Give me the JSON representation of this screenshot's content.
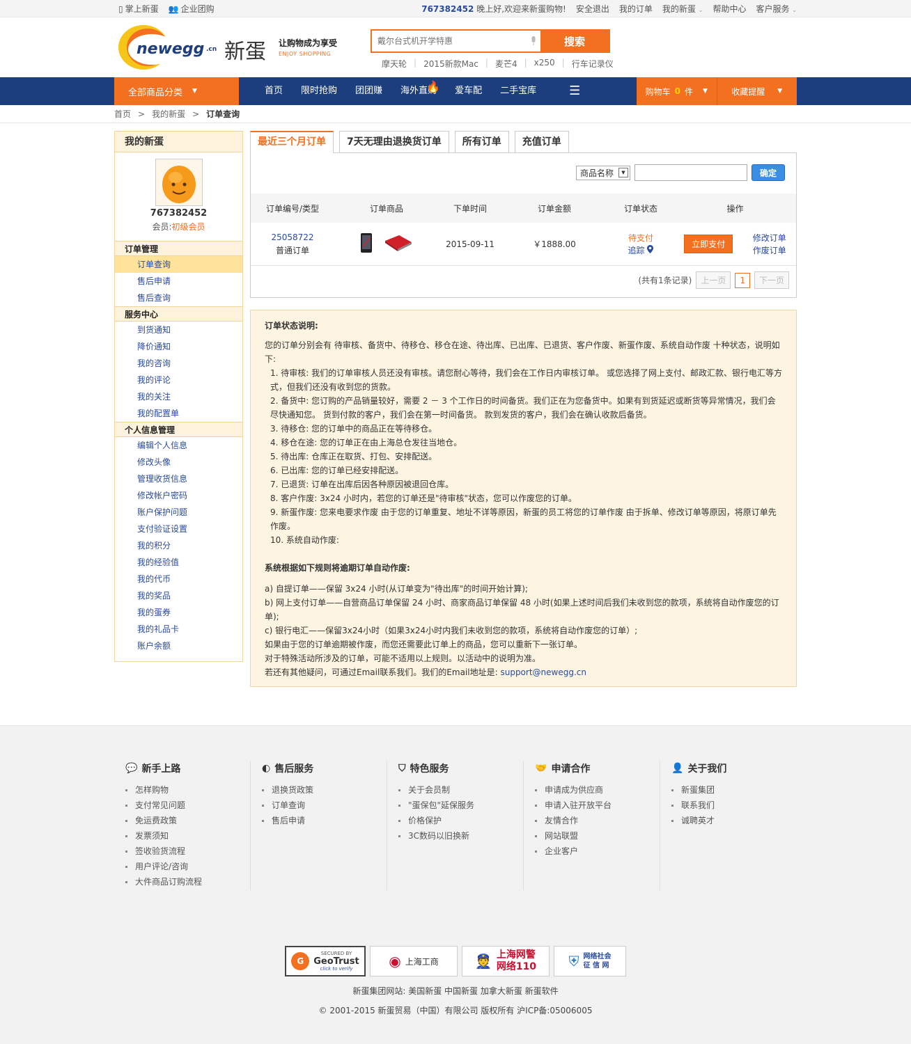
{
  "topbar": {
    "mobile": "掌上新蛋",
    "enterprise": "企业团购",
    "user": "767382452",
    "greeting": "晚上好,欢迎来新蛋购物!",
    "logout": "安全退出",
    "my_orders": "我的订单",
    "my_newegg": "我的新蛋",
    "help": "帮助中心",
    "service": "客户服务"
  },
  "header": {
    "logo_text": "newegg",
    "logo_suffix": ".cn",
    "brand_cn": "新蛋",
    "slogan": "让购物成为享受",
    "slogan_en": "ENJOY SHOPPING",
    "search_placeholder": "戴尔台式机开学特惠",
    "search_button": "搜索",
    "hotwords": [
      "摩天轮",
      "2015新款Mac",
      "麦芒4",
      "x250",
      "行车记录仪"
    ]
  },
  "nav": {
    "all_categories": "全部商品分类",
    "items": [
      "首页",
      "限时抢购",
      "团团赚",
      "海外直购",
      "爱车配",
      "二手宝库"
    ],
    "cart_label": "购物车",
    "cart_count": "0",
    "cart_unit": "件",
    "favorites": "收藏提醒"
  },
  "breadcrumb": {
    "home": "首页",
    "mynewegg": "我的新蛋",
    "current": "订单查询"
  },
  "sidebar": {
    "title": "我的新蛋",
    "user_id": "767382452",
    "member_label": "会员:",
    "member_level": "初级会员",
    "groups": [
      {
        "title": "订单管理",
        "items": [
          "订单查询",
          "售后申请",
          "售后查询"
        ]
      },
      {
        "title": "服务中心",
        "items": [
          "到货通知",
          "降价通知",
          "我的咨询",
          "我的评论",
          "我的关注",
          "我的配置单"
        ]
      },
      {
        "title": "个人信息管理",
        "items": [
          "编辑个人信息",
          "修改头像",
          "管理收货信息",
          "修改帐户密码",
          "账户保护问题",
          "支付验证设置",
          "我的积分",
          "我的经验值",
          "我的代币",
          "我的奖品",
          "我的蛋券",
          "我的礼品卡",
          "账户余额"
        ]
      }
    ]
  },
  "tabs": [
    "最近三个月订单",
    "7天无理由退换货订单",
    "所有订单",
    "充值订单"
  ],
  "filter": {
    "select_value": "商品名称",
    "confirm": "确定"
  },
  "table": {
    "headers": [
      "订单编号/类型",
      "订单商品",
      "下单时间",
      "订单金额",
      "订单状态",
      "操作"
    ],
    "rows": [
      {
        "order_id": "25058722",
        "order_type": "普通订单",
        "date": "2015-09-11",
        "amount": "￥1888.00",
        "status": "待支付",
        "track": "追踪",
        "pay": "立即支付",
        "modify": "修改订单",
        "cancel": "作废订单"
      }
    ]
  },
  "pager": {
    "summary": "(共有1条记录)",
    "prev": "上一页",
    "page": "1",
    "next": "下一页"
  },
  "note": {
    "title": "订单状态说明:",
    "intro": "您的订单分别会有 待审核、备货中、待移仓、移仓在途、待出库、已出库、已退货、客户作废、新蛋作废、系统自动作废 十种状态，说明如下:",
    "items": [
      "1. 待审核:   我们的订单审核人员还没有审核。请您耐心等待，我们会在工作日内审核订单。 或您选择了网上支付、邮政汇款、银行电汇等方式，但我们还没有收到您的货款。",
      "2. 备货中:   您订购的产品销量较好，需要 2 － 3 个工作日的时间备货。我们正在为您备货中。如果有到货延迟或断货等异常情况，我们会尽快通知您。 货到付款的客户，我们会在第一时间备货。 款到发货的客户，我们会在确认收款后备货。",
      "3. 待移仓:   您的订单中的商品正在等待移仓。",
      "4. 移仓在途:   您的订单正在由上海总仓发往当地仓。",
      "5. 待出库:   仓库正在取货、打包、安排配送。",
      "6. 已出库:   您的订单已经安排配送。",
      "7. 已退货:   订单在出库后因各种原因被退回仓库。",
      "8. 客户作废:   3x24 小时内，若您的订单还是\"待审核\"状态，您可以作废您的订单。",
      "9. 新蛋作废:   您来电要求作废 由于您的订单重复、地址不详等原因，新蛋的员工将您的订单作废 由于拆单、修改订单等原因，将原订单先作废。",
      "10. 系统自动作废:"
    ],
    "rule_title": "系统根据如下规则将逾期订单自动作废:",
    "rules": [
      "a) 自提订单——保留 3x24 小时(从订单变为\"待出库\"的时间开始计算);",
      "b) 网上支付订单——自营商品订单保留 24 小时、商家商品订单保留 48 小时(如果上述时间后我们未收到您的款项，系统将自动作废您的订单);",
      "c) 银行电汇——保留3x24小时（如果3x24小时内我们未收到您的款项，系统将自动作废您的订单）;",
      "如果由于您的订单逾期被作废，而您还需要此订单上的商品，您可以重新下一张订单。",
      "对于特殊活动所涉及的订单，可能不适用以上规则。以活动中的说明为准。"
    ],
    "contact": "若还有其他疑问，可通过Email联系我们。我们的Email地址是:",
    "email": "support@newegg.cn"
  },
  "footer": {
    "columns": [
      {
        "title": "新手上路",
        "icon": "chat-icon",
        "links": [
          "怎样购物",
          "支付常见问题",
          "免运费政策",
          "发票须知",
          "签收验货流程",
          "用户评论/咨询",
          "大件商品订购流程"
        ]
      },
      {
        "title": "售后服务",
        "icon": "aftersale-icon",
        "links": [
          "退换货政策",
          "订单查询",
          "售后申请"
        ]
      },
      {
        "title": "特色服务",
        "icon": "shield-icon",
        "links": [
          "关于会员制",
          "\"蛋保包\"延保服务",
          "价格保护",
          "3C数码以旧换新"
        ]
      },
      {
        "title": "申请合作",
        "icon": "handshake-icon",
        "links": [
          "申请成为供应商",
          "申请入驻开放平台",
          "友情合作",
          "网站联盟",
          "企业客户"
        ]
      },
      {
        "title": "关于我们",
        "icon": "person-icon",
        "links": [
          "新蛋集团",
          "联系我们",
          "诚聘英才"
        ]
      }
    ],
    "badges": {
      "geotrust_top": "SECURED BY",
      "geotrust": "GeoTrust",
      "geotrust_sub": "click to verify",
      "gongshang": "上海工商",
      "police1": "上海网警",
      "police2": "网络110",
      "credit1": "网络社会",
      "credit2": "征 信 网"
    },
    "group_sites": "新蛋集团网站:  美国新蛋   中国新蛋   加拿大新蛋   新蛋软件",
    "copyright": "© 2001-2015  新蛋贸易（中国）有限公司  版权所有  沪ICP备:05006005"
  },
  "colors": {
    "accent": "#f37021",
    "nav": "#1d3e7c",
    "link": "#2a4a9c"
  }
}
